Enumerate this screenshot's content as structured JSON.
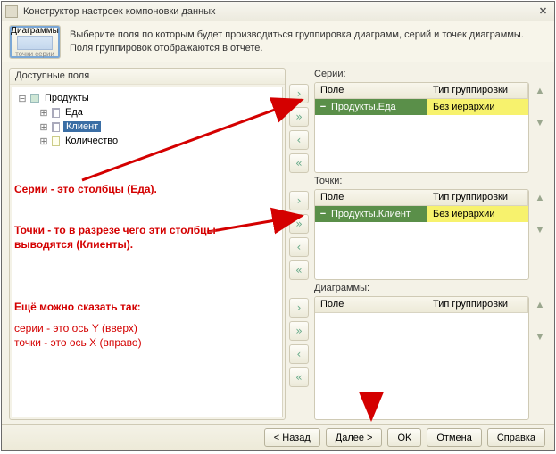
{
  "title": "Конструктор настроек компоновки данных",
  "toolbar": {
    "btn_label": "Диаграммы",
    "side1": "точки",
    "side2": "серии",
    "hint": "Выберите поля по которым будет производиться группировка диаграмм, серий и точек диаграммы. Поля группировок отображаются в отчете."
  },
  "left": {
    "header": "Доступные поля",
    "tree": {
      "root": "Продукты",
      "items": [
        {
          "label": "Еда"
        },
        {
          "label": "Клиент",
          "selected": true
        },
        {
          "label": "Количество"
        }
      ]
    }
  },
  "cols": {
    "field": "Поле",
    "grouptype": "Тип группировки"
  },
  "series": {
    "caption": "Серии:",
    "row": {
      "field": "Продукты.Еда",
      "group": "Без иерархии"
    }
  },
  "points": {
    "caption": "Точки:",
    "row": {
      "field": "Продукты.Клиент",
      "group": "Без иерархии"
    }
  },
  "diagrams": {
    "caption": "Диаграммы:"
  },
  "footer": {
    "back": "< Назад",
    "next": "Далее >",
    "ok": "OK",
    "cancel": "Отмена",
    "help": "Справка"
  },
  "annotations": {
    "a1": "Серии - это столбцы (Еда).",
    "a2": "Точки - то в разрезе чего эти столбцы\nвыводятся (Клиенты).",
    "a3": "Ещё можно сказать так:",
    "a4": "серии - это ось Y (вверх)\nточки - это ось X (вправо)"
  }
}
